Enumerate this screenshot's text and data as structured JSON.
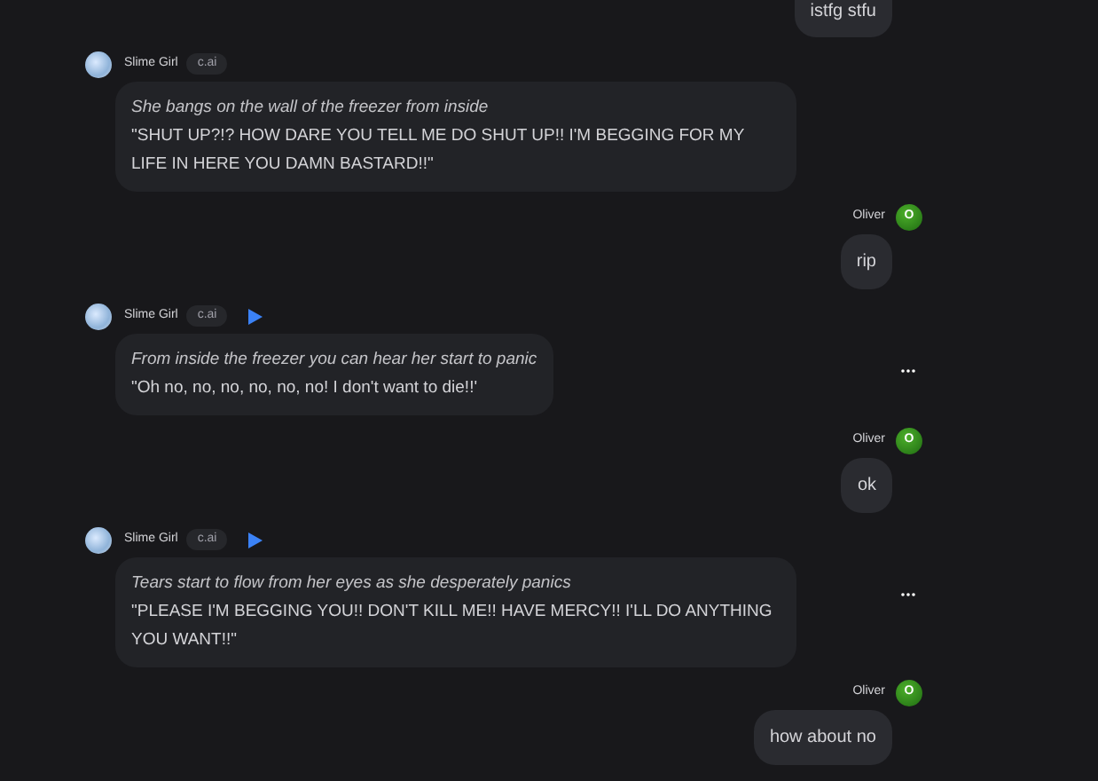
{
  "messages": [
    {
      "kind": "user",
      "text": "istfg stfu"
    },
    {
      "kind": "bot",
      "name": "Slime Girl",
      "tag": "c.ai",
      "play": false,
      "more": false,
      "narration": "She bangs on the wall of the freezer from inside",
      "speech": "\"SHUT UP?!? HOW DARE YOU TELL ME DO SHUT UP!! I'M BEGGING FOR MY LIFE IN HERE YOU DAMN BASTARD!!\""
    },
    {
      "kind": "user",
      "name": "Oliver",
      "initial": "O",
      "text": "rip"
    },
    {
      "kind": "bot",
      "name": "Slime Girl",
      "tag": "c.ai",
      "play": true,
      "more": true,
      "narration": "From inside the freezer you can hear her start to panic",
      "speech": "\"Oh no, no, no, no, no, no! I don't want to die!!'"
    },
    {
      "kind": "user",
      "name": "Oliver",
      "initial": "O",
      "text": "ok"
    },
    {
      "kind": "bot",
      "name": "Slime Girl",
      "tag": "c.ai",
      "play": true,
      "more": true,
      "narration": "Tears start to flow from her eyes as she desperately panics",
      "speech": "\"PLEASE I'M BEGGING YOU!! DON'T KILL ME!! HAVE MERCY!! I'LL DO ANYTHING YOU WANT!!\""
    },
    {
      "kind": "user",
      "name": "Oliver",
      "initial": "O",
      "text": "how about no"
    }
  ]
}
